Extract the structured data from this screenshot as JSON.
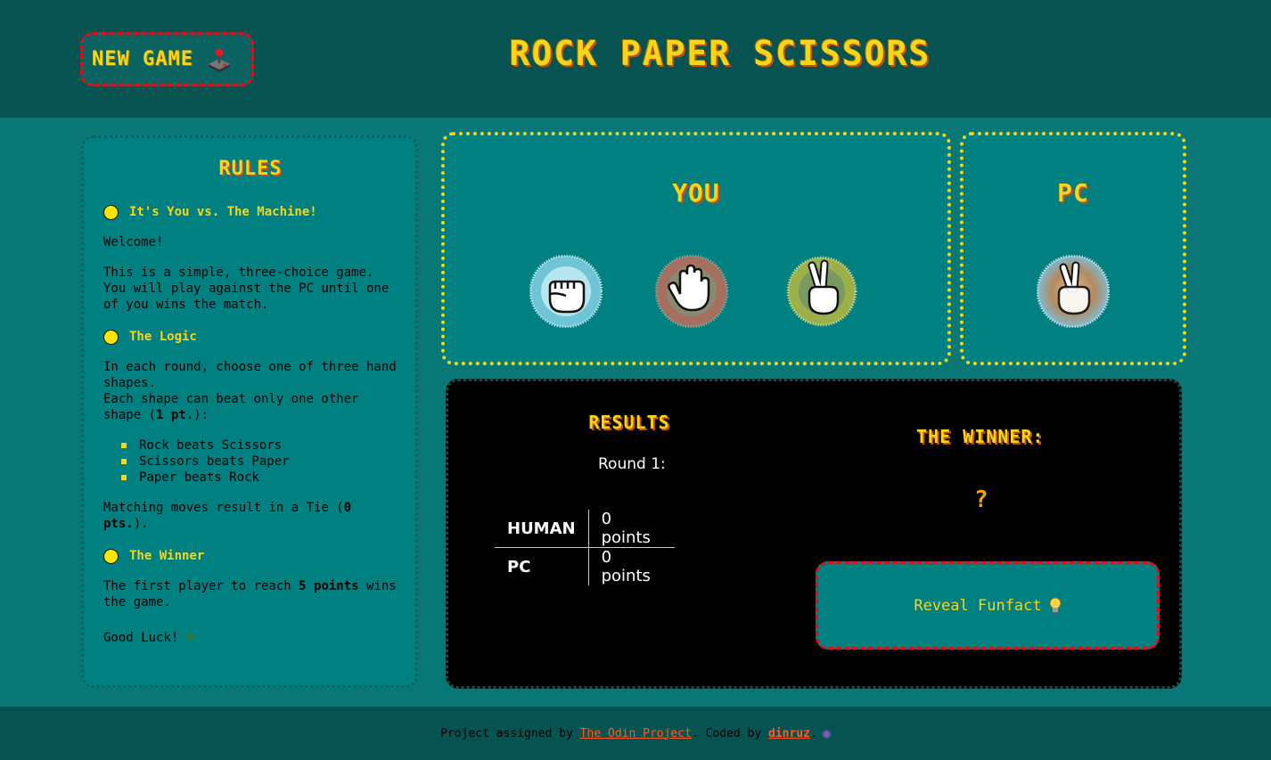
{
  "header": {
    "new_game_label": "NEW GAME",
    "title": "ROCK PAPER SCISSORS"
  },
  "rules": {
    "title": "RULES",
    "section1_title": "It's You vs. The Machine!",
    "welcome": "Welcome!",
    "intro": "This is a simple, three-choice game. You will play against the PC until one of you wins the match.",
    "section2_title": "The Logic",
    "logic1": "In each round, choose one of three hand shapes.",
    "logic2a": "Each shape can beat only one other shape (",
    "logic2b": "1 pt.",
    "logic2c": "):",
    "beats": [
      "Rock beats Scissors",
      "Scissors beats Paper",
      "Paper beats Rock"
    ],
    "tie_a": "Matching moves result in a Tie (",
    "tie_b": "0 pts.",
    "tie_c": ").",
    "section3_title": "The Winner",
    "winner_a": "The first player to reach ",
    "winner_b": "5 points",
    "winner_c": " wins the game.",
    "good_luck": "Good Luck!"
  },
  "you": {
    "title": "YOU",
    "choices": [
      "rock-icon",
      "paper-icon",
      "scissors-icon"
    ]
  },
  "pc": {
    "title": "PC",
    "choice": "shuffle-icon"
  },
  "results": {
    "title": "RESULTS",
    "round": "Round 1:",
    "rows": [
      {
        "player": "HUMAN",
        "score": "0 points"
      },
      {
        "player": "PC",
        "score": "0 points"
      }
    ],
    "winner_title": "THE WINNER:",
    "winner_value": "?",
    "funfact_label": "Reveal Funfact"
  },
  "footer": {
    "text_a": "Project assigned by ",
    "link1": "The Odin Project",
    "text_b": ". Coded by ",
    "link2": "dinruz",
    "text_c": "."
  },
  "colors": {
    "yellow": "#f7d517",
    "red_dash": "#e00e1a",
    "teal": "#008080",
    "dark_teal": "#065352"
  }
}
